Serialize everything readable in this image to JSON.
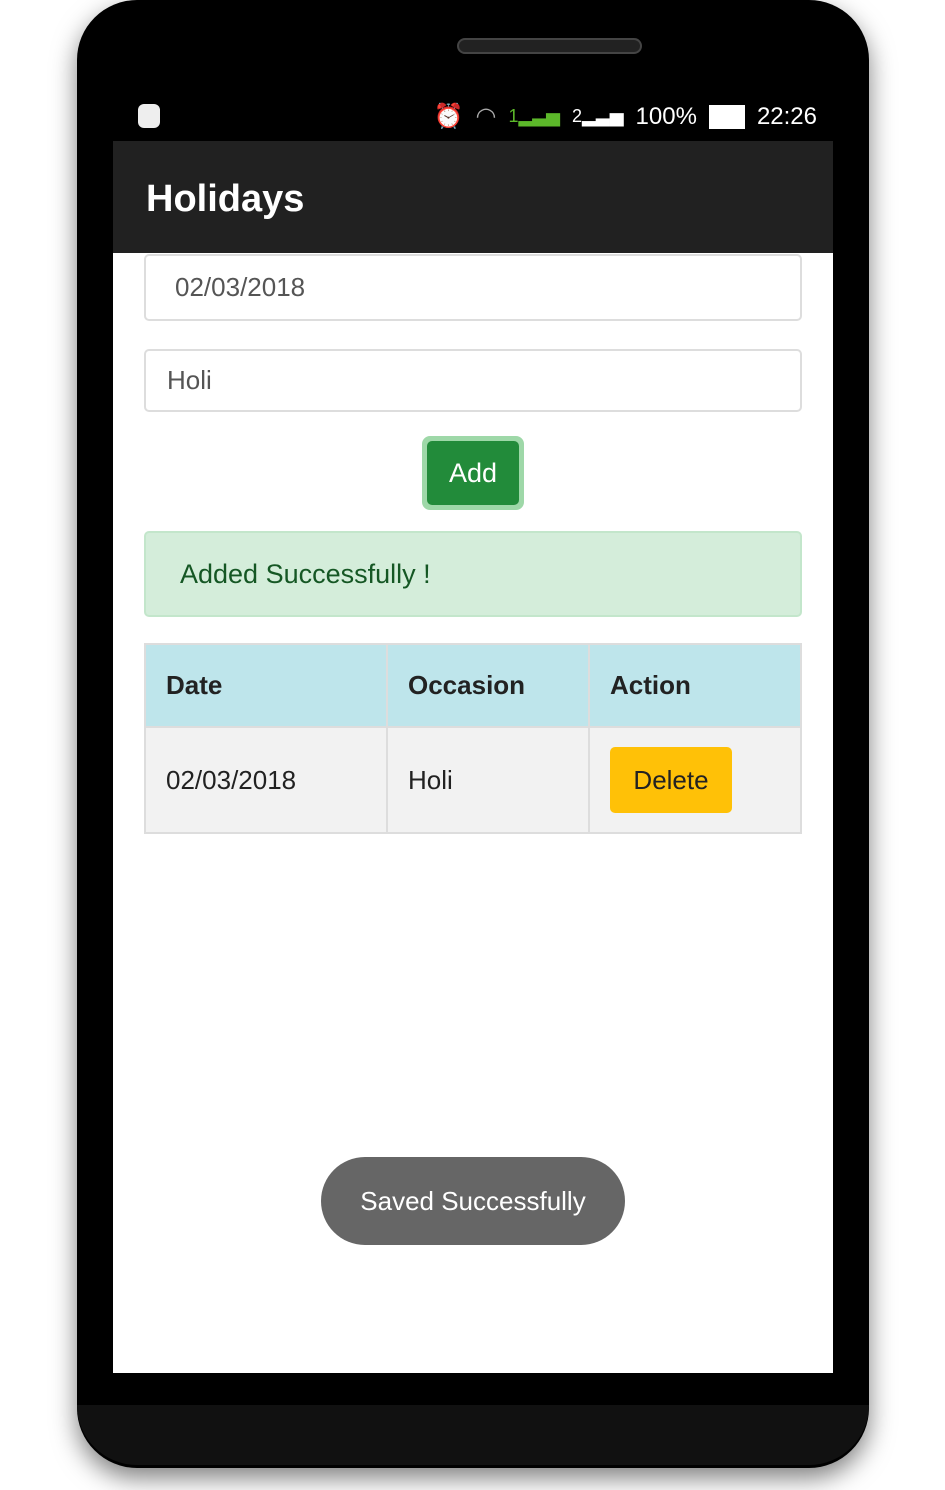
{
  "status_bar": {
    "battery": "100%",
    "time": "22:26",
    "sim1": "1",
    "sim2": "2",
    "icons": [
      "android-icon",
      "alarm-icon",
      "wifi-icon",
      "signal-icon",
      "battery-icon"
    ]
  },
  "app_bar": {
    "title": "Holidays"
  },
  "form": {
    "date_value": "02/03/2018",
    "occasion_value": "Holi",
    "add_label": "Add"
  },
  "alert": {
    "message": "Added Successfully !"
  },
  "table": {
    "headers": [
      "Date",
      "Occasion",
      "Action"
    ],
    "rows": [
      {
        "date": "02/03/2018",
        "occasion": "Holi",
        "action": "Delete"
      }
    ]
  },
  "toast": {
    "message": "Saved Successfully"
  },
  "colors": {
    "add": "#228b3a",
    "alert_bg": "#d4edda",
    "header_bg": "#bee5eb",
    "delete": "#ffc107"
  }
}
